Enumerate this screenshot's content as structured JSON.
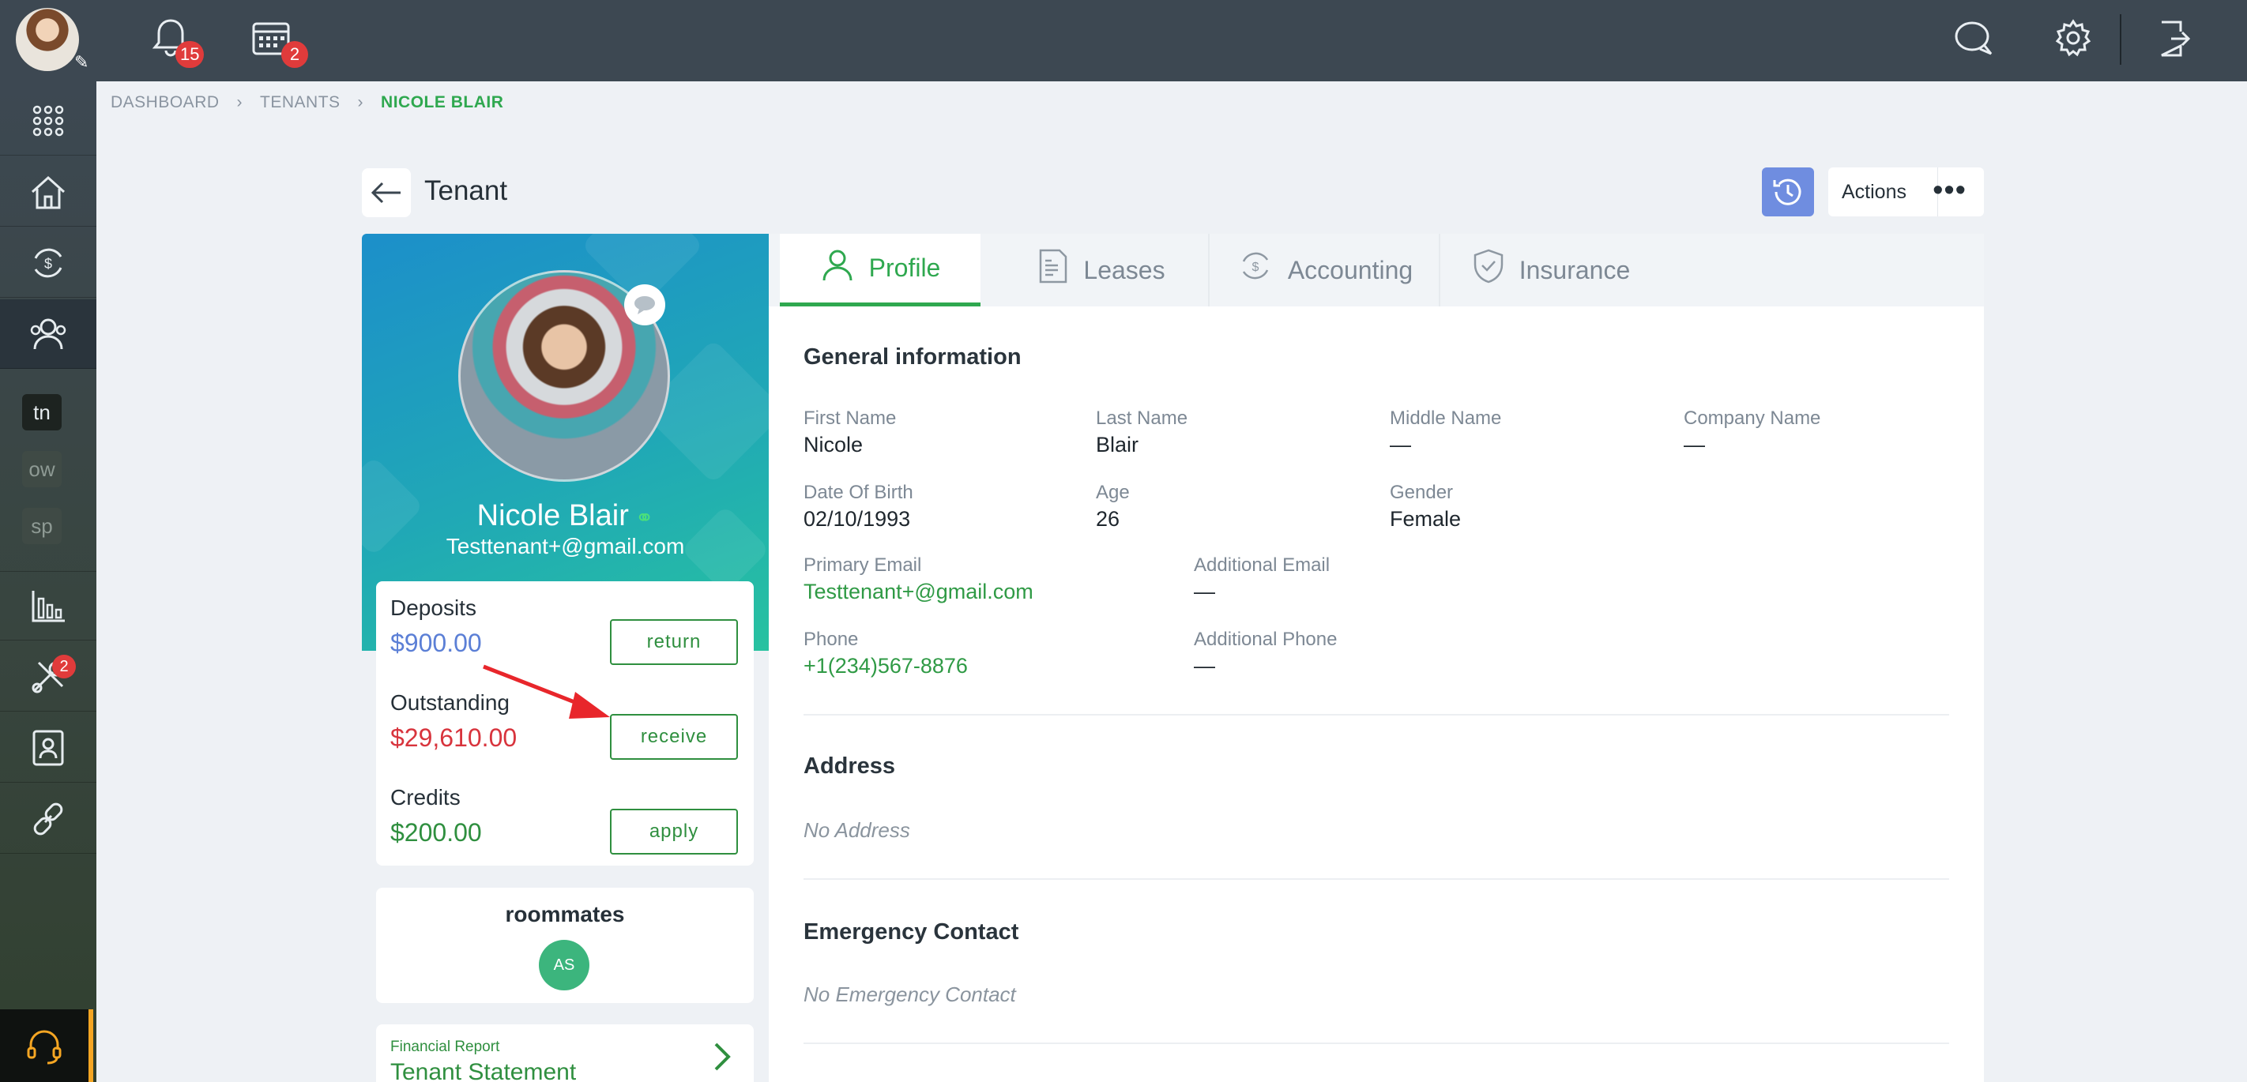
{
  "topbar": {
    "notifications_count": "15",
    "calendar_count": "2"
  },
  "sidebar": {
    "chips": [
      "tn",
      "ow",
      "sp"
    ],
    "tools_badge": "2"
  },
  "breadcrumb": [
    "DASHBOARD",
    "TENANTS",
    "NICOLE BLAIR"
  ],
  "header": {
    "title": "Tenant",
    "actions_label": "Actions",
    "more_label": "•••"
  },
  "tenant": {
    "name": "Nicole Blair",
    "email": "Testtenant+@gmail.com"
  },
  "balances": {
    "deposits_label": "Deposits",
    "deposits_amount": "$900.00",
    "deposits_action": "return",
    "outstanding_label": "Outstanding",
    "outstanding_amount": "$29,610.00",
    "outstanding_action": "receive",
    "credits_label": "Credits",
    "credits_amount": "$200.00",
    "credits_action": "apply"
  },
  "roommates": {
    "title": "roommates",
    "initials": "AS"
  },
  "financial_report": {
    "small": "Financial Report",
    "title": "Tenant Statement"
  },
  "tabs": [
    "Profile",
    "Leases",
    "Accounting",
    "Insurance"
  ],
  "general": {
    "title": "General information",
    "first_name_label": "First Name",
    "first_name": "Nicole",
    "last_name_label": "Last Name",
    "last_name": "Blair",
    "middle_name_label": "Middle Name",
    "middle_name": "—",
    "company_label": "Company Name",
    "company": "—",
    "dob_label": "Date Of Birth",
    "dob": "02/10/1993",
    "age_label": "Age",
    "age": "26",
    "gender_label": "Gender",
    "gender": "Female",
    "primary_email_label": "Primary Email",
    "primary_email": "Testtenant+@gmail.com",
    "additional_email_label": "Additional Email",
    "additional_email": "—",
    "phone_label": "Phone",
    "phone": "+1(234)567-8876",
    "additional_phone_label": "Additional Phone",
    "additional_phone": "—"
  },
  "address": {
    "title": "Address",
    "empty": "No Address"
  },
  "emergency": {
    "title": "Emergency Contact",
    "empty": "No Emergency Contact"
  },
  "colors": {
    "accent_green": "#2fa84f",
    "danger_red": "#d8343d",
    "deposit_blue": "#5b7fd6"
  }
}
